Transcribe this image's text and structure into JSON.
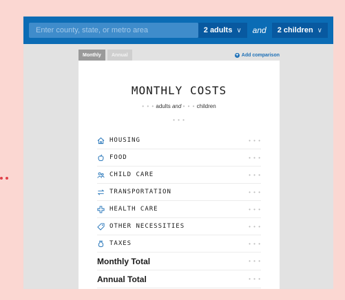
{
  "search": {
    "placeholder": "Enter county, state, or metro area"
  },
  "selectors": {
    "adults": "2 adults",
    "connector": "and",
    "children": "2 children"
  },
  "tabs": [
    {
      "label": "Monthly",
      "active": true
    },
    {
      "label": "Annual",
      "active": false
    }
  ],
  "add_comparison": "Add comparison",
  "card": {
    "title": "MONTHLY COSTS",
    "subtitle_dots": "• • •",
    "subtitle_adults": "adults",
    "subtitle_and": "and",
    "subtitle_children": "children",
    "placeholder_dots": "• • •"
  },
  "rows": [
    {
      "label": "HOUSING",
      "icon": "house-icon",
      "value": "• • •"
    },
    {
      "label": "FOOD",
      "icon": "apple-icon",
      "value": "• • •"
    },
    {
      "label": "CHILD CARE",
      "icon": "people-icon",
      "value": "• • •"
    },
    {
      "label": "TRANSPORTATION",
      "icon": "arrows-icon",
      "value": "• • •"
    },
    {
      "label": "HEALTH CARE",
      "icon": "medical-cross-icon",
      "value": "• • •"
    },
    {
      "label": "OTHER NECESSITIES",
      "icon": "tag-icon",
      "value": "• • •"
    },
    {
      "label": "TAXES",
      "icon": "money-bag-icon",
      "value": "• • •"
    }
  ],
  "totals": [
    {
      "label": "Monthly Total",
      "value": "• • •"
    },
    {
      "label": "Annual Total",
      "value": "• • •"
    }
  ],
  "colors": {
    "accent_blue": "#0b6cb5",
    "icon_blue": "#1c6fb6",
    "page_bg": "#fbd7d2",
    "dots_red": "#e0424a"
  }
}
